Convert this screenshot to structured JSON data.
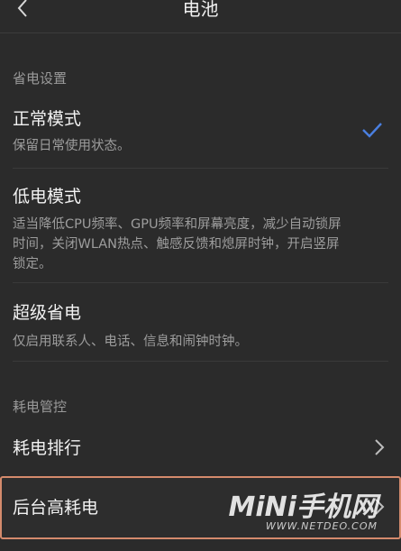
{
  "header": {
    "title": "电池",
    "back_icon": "chevron-left-icon"
  },
  "sections": {
    "power_saving": {
      "label": "省电设置",
      "items": [
        {
          "title": "正常模式",
          "desc": "保留日常使用状态。",
          "selected": true,
          "check_icon": "checkmark-icon"
        },
        {
          "title": "低电模式",
          "desc": "适当降低CPU频率、GPU频率和屏幕亮度，减少自动锁屏时间，关闭WLAN热点、触感反馈和熄屏时钟，开启竖屏锁定。",
          "selected": false
        },
        {
          "title": "超级省电",
          "desc": "仅启用联系人、电话、信息和闹钟时钟。",
          "selected": false
        }
      ]
    },
    "consumption": {
      "label": "耗电管控",
      "items": [
        {
          "title": "耗电排行",
          "chevron_icon": "chevron-right-icon"
        },
        {
          "title": "后台高耗电",
          "chevron_icon": "chevron-right-icon"
        }
      ]
    }
  },
  "watermark": {
    "brand": "MiNi手机网",
    "site": "WWW.NETDEO.COM"
  },
  "colors": {
    "background": "#2b2b2b",
    "accent_check": "#4a7fe0",
    "highlight_border": "#d48a6c"
  }
}
